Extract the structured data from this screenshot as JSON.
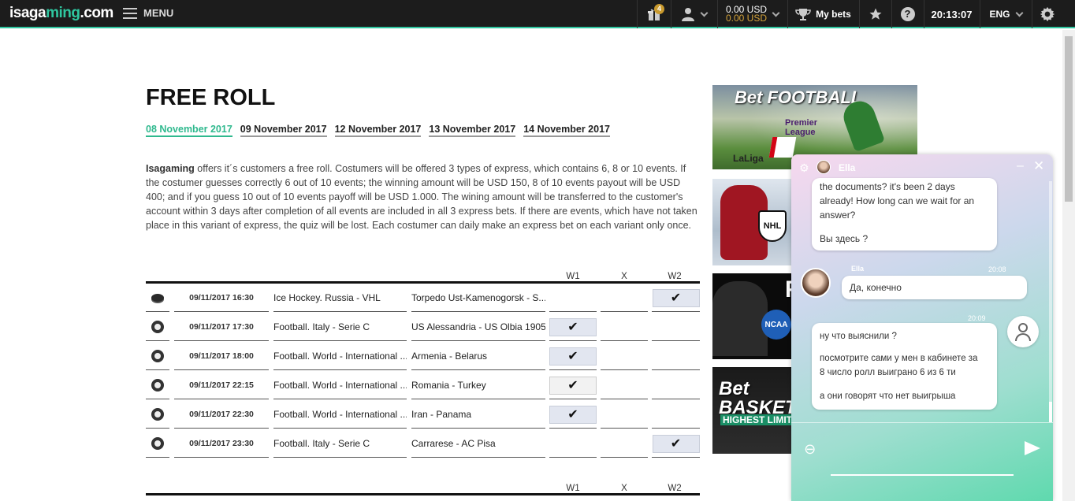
{
  "topbar": {
    "logo_main": "isaga",
    "logo_accent": "ming",
    "logo_tail": ".com",
    "menu_label": "MENU",
    "gift_badge": "4",
    "balance_primary": "0.00 USD",
    "balance_secondary": "0.00 USD",
    "my_bets_label": "My bets",
    "help_glyph": "?",
    "clock": "20:13:07",
    "language": "ENG",
    "colors": {
      "accent": "#2fc7a0",
      "bar_bg": "#1c1c1c",
      "bonus": "#d4a33a"
    }
  },
  "page": {
    "title": "FREE ROLL",
    "date_tabs": [
      {
        "label": "08 November 2017",
        "active": true
      },
      {
        "label": "09 November 2017",
        "active": false
      },
      {
        "label": "12 November 2017",
        "active": false
      },
      {
        "label": "13 November 2017",
        "active": false
      },
      {
        "label": "14 November 2017",
        "active": false
      }
    ],
    "description_brand": "Isagaming",
    "description": " offers it´s customers a free roll. Costumers will be offered 3 types of express, which contains 6, 8 or 10 events. If the costumer guesses correctly 6 out of 10 events; the winning amount will be USD 150, 8 of 10 events payout will be USD 400; and if you guess 10 out of 10 events payoff will be USD 1.000. The wining amount will be transferred to the customer's account within 3 days after completion of all events are included in all 3 express bets. If there are events, which have not taken place in this variant of express, the quiz will be lost. Each costumer can daily make an express bet on each variant only once."
  },
  "table": {
    "columns": {
      "w1": "W1",
      "x": "X",
      "w2": "W2"
    },
    "check_glyph": "✔",
    "rows": [
      {
        "sport_icon": "hockey-puck-icon",
        "datetime": "09/11/2017 16:30",
        "league": "Ice Hockey. Russia - VHL",
        "event": "Torpedo Ust-Kamenogorsk - S...",
        "pick": "w2"
      },
      {
        "sport_icon": "football-icon",
        "datetime": "09/11/2017 17:30",
        "league": "Football. Italy - Serie C",
        "event": "US Alessandria - US Olbia 1905",
        "pick": "w1"
      },
      {
        "sport_icon": "football-icon",
        "datetime": "09/11/2017 18:00",
        "league": "Football. World - International ...",
        "event": "Armenia - Belarus",
        "pick": "w1"
      },
      {
        "sport_icon": "football-icon",
        "datetime": "09/11/2017 22:15",
        "league": "Football. World - International ...",
        "event": "Romania - Turkey",
        "pick": "w1"
      },
      {
        "sport_icon": "football-icon",
        "datetime": "09/11/2017 22:30",
        "league": "Football. World - International ...",
        "event": "Iran - Panama",
        "pick": "w1"
      },
      {
        "sport_icon": "football-icon",
        "datetime": "09/11/2017 23:30",
        "league": "Football. Italy - Serie C",
        "event": "Carrarese - AC Pisa",
        "pick": "w2"
      }
    ],
    "second_columns": {
      "w1": "W1",
      "x": "X",
      "w2": "W2"
    }
  },
  "banners": {
    "football_title": "Bet FOOTBALL",
    "football_league1": "Premier League",
    "football_league2": "LaLiga",
    "hockey_badge": "NHL",
    "ncaa_badge": "NCAA",
    "basket_title": "Bet BASKETBALL",
    "basket_sub": "HIGHEST LIMIT"
  },
  "chat": {
    "agent_name": "Ella",
    "minimize_glyph": "–",
    "close_glyph": "✕",
    "msg1_lines": [
      "the documents? it's been 2 days",
      "already! How long can we wait for an",
      "answer?",
      "Вы здесь ?"
    ],
    "msg2_sender": "Ella",
    "msg2_time": "20:08",
    "msg2_text": "Да, конечно",
    "msg3_time": "20:09",
    "msg3_lines": [
      "ну  что выяснили ?",
      "посмотрите сами у мен в кабинете  за",
      " 8 число ролл  выиграно  6  из  6  ти",
      "а  они говорят  что нет выигрыша"
    ],
    "input_value": "",
    "colors": {
      "gradient_top": "#f7d8ee",
      "gradient_bottom": "#5fd9ae"
    }
  }
}
